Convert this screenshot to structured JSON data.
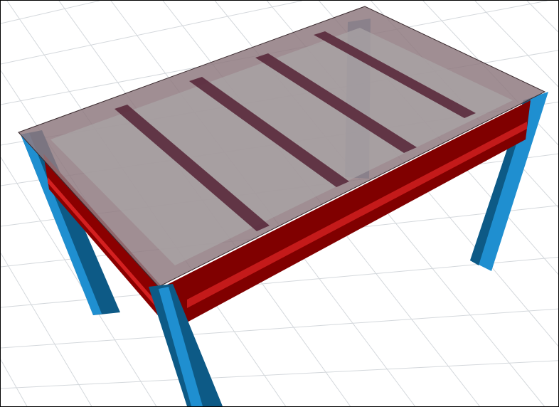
{
  "viewport": {
    "view": "3d-perspective",
    "colors": {
      "background": "#ffffff",
      "grid": "#d4d8dc",
      "beam": "#8b0000",
      "beam_top": "#c01818",
      "column": "#1f8fd0",
      "column_dark": "#0d5a86",
      "grating": "#8a6a70",
      "joist": "#5a2a3c"
    }
  }
}
